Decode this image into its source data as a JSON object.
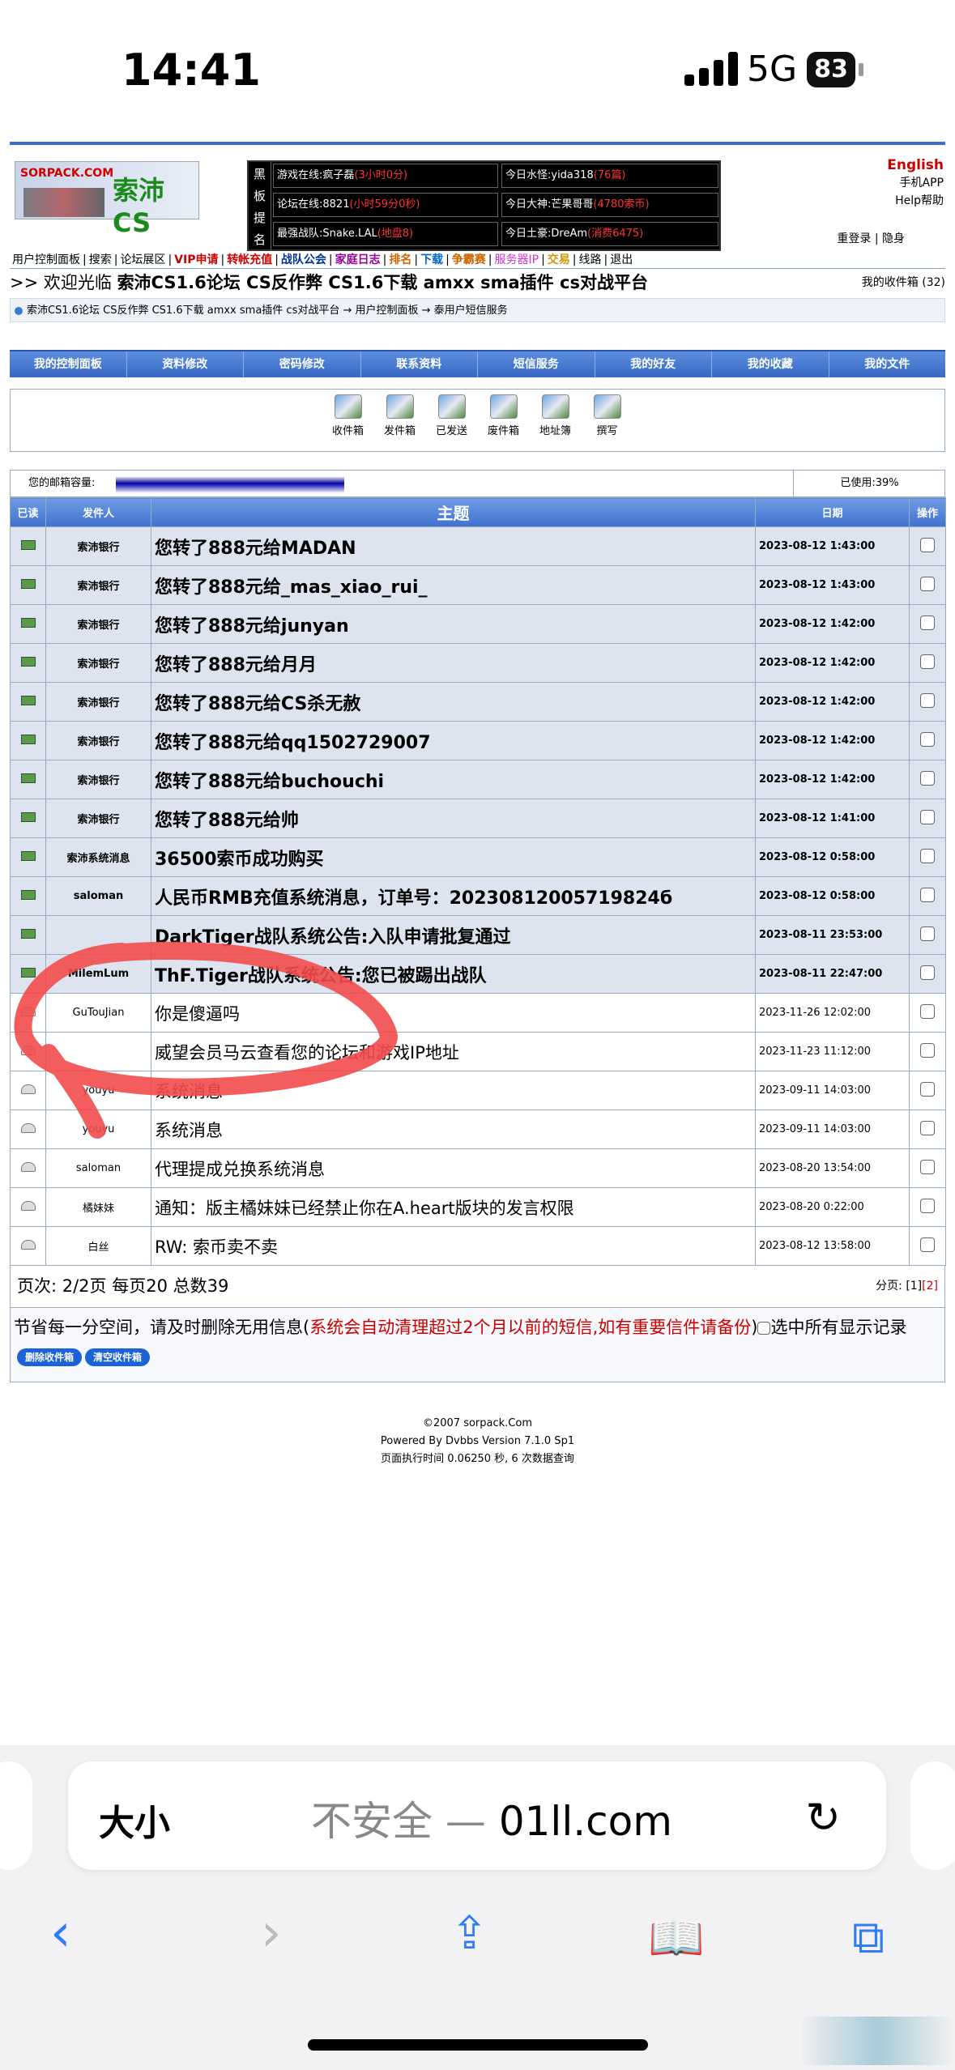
{
  "status": {
    "time": "14:41",
    "network": "5G",
    "battery": "83"
  },
  "header": {
    "logo_text": "SORPACK.COM",
    "logo_title": "索沛CS",
    "vert": [
      "黑",
      "板",
      "提",
      "名"
    ],
    "cells": [
      [
        "游戏在线:疯子磊",
        "(3小时0分)"
      ],
      [
        "今日水怪:yida318",
        "(76篇)"
      ],
      [
        "论坛在线:8821",
        "(小时59分0秒)"
      ],
      [
        "今日大神:芒果哥哥",
        "(4780索币)"
      ],
      [
        "最强战队:Snake.LAL",
        "(地盘8)"
      ],
      [
        "今日土豪:DreAm",
        "(消费6475)"
      ]
    ],
    "english": "English",
    "app": "手机APP",
    "help": "Help帮助",
    "relogin": "重登录",
    "hide": "隐身"
  },
  "menu": [
    "用户控制面板",
    "搜索",
    "论坛展区",
    "VIP申请",
    "转帐充值",
    "战队公会",
    "家庭日志",
    "排名",
    "下载",
    "争霸赛",
    "服务器IP",
    "交易",
    "线路",
    "退出"
  ],
  "welcome": {
    "prefix": ">> 欢迎光临",
    "site": "索沛CS1.6论坛 CS反作弊 CS1.6下载 amxx sma插件 cs对战平台",
    "fav": "我的收件箱 (32)"
  },
  "breadcrumb": "索沛CS1.6论坛 CS反作弊 CS1.6下载 amxx sma插件 cs对战平台 → 用户控制面板 → 泰用户短信服务",
  "tabs": [
    "我的控制面板",
    "资料修改",
    "密码修改",
    "联系资料",
    "短信服务",
    "我的好友",
    "我的收藏",
    "我的文件"
  ],
  "icons": [
    {
      "name": "inbox-icon",
      "label": "收件箱"
    },
    {
      "name": "outbox-icon",
      "label": "发件箱"
    },
    {
      "name": "sent-icon",
      "label": "已发送"
    },
    {
      "name": "trash-icon",
      "label": "废件箱"
    },
    {
      "name": "addressbook-icon",
      "label": "地址簿"
    },
    {
      "name": "compose-icon",
      "label": "撰写"
    }
  ],
  "capacity": {
    "label": "您的邮箱容量:",
    "used": "已使用:39%",
    "fraction": 0.39
  },
  "table": {
    "headers": [
      "已读",
      "发件人",
      "主题",
      "日期",
      "操作"
    ],
    "rows": [
      {
        "read": false,
        "sender": "索沛银行",
        "subject": "您转了888元给MADAN",
        "date": "2023-08-12 1:43:00"
      },
      {
        "read": false,
        "sender": "索沛银行",
        "subject": "您转了888元给_mas_xiao_rui_",
        "date": "2023-08-12 1:43:00"
      },
      {
        "read": false,
        "sender": "索沛银行",
        "subject": "您转了888元给junyan",
        "date": "2023-08-12 1:42:00"
      },
      {
        "read": false,
        "sender": "索沛银行",
        "subject": "您转了888元给月月",
        "date": "2023-08-12 1:42:00"
      },
      {
        "read": false,
        "sender": "索沛银行",
        "subject": "您转了888元给CS杀无赦",
        "date": "2023-08-12 1:42:00"
      },
      {
        "read": false,
        "sender": "索沛银行",
        "subject": "您转了888元给qq1502729007",
        "date": "2023-08-12 1:42:00"
      },
      {
        "read": false,
        "sender": "索沛银行",
        "subject": "您转了888元给buchouchi",
        "date": "2023-08-12 1:42:00"
      },
      {
        "read": false,
        "sender": "索沛银行",
        "subject": "您转了888元给帅",
        "date": "2023-08-12 1:41:00"
      },
      {
        "read": false,
        "sender": "索沛系统消息",
        "subject": "36500索币成功购买",
        "date": "2023-08-12 0:58:00"
      },
      {
        "read": false,
        "sender": "saloman",
        "subject": "人民币RMB充值系统消息，订单号：20230812005719824б",
        "date": "2023-08-12 0:58:00"
      },
      {
        "read": false,
        "sender": "",
        "subject": "DarkTiger战队系统公告:入队申请批复通过",
        "date": "2023-08-11 23:53:00"
      },
      {
        "read": false,
        "sender": "MilemLum",
        "subject": "ThF.Tiger战队系统公告:您已被踢出战队",
        "date": "2023-08-11 22:47:00"
      },
      {
        "read": true,
        "sender": "GuTouJian",
        "subject": "你是傻逼吗",
        "date": "2023-11-26 12:02:00"
      },
      {
        "read": true,
        "sender": "",
        "subject": "威望会员马云查看您的论坛和游戏IP地址",
        "date": "2023-11-23 11:12:00"
      },
      {
        "read": true,
        "sender": "youyu",
        "subject": "系统消息",
        "date": "2023-09-11 14:03:00"
      },
      {
        "read": true,
        "sender": "youyu",
        "subject": "系统消息",
        "date": "2023-09-11 14:03:00"
      },
      {
        "read": true,
        "sender": "saloman",
        "subject": "代理提成兑换系统消息",
        "date": "2023-08-20 13:54:00"
      },
      {
        "read": true,
        "sender": "橘妹妹",
        "subject": "通知：版主橘妹妹已经禁止你在A.heart版块的发言权限",
        "date": "2023-08-20 0:22:00"
      },
      {
        "read": true,
        "sender": "白丝",
        "subject": "RW: 索币卖不卖",
        "date": "2023-08-12 13:58:00"
      }
    ]
  },
  "pager": {
    "info": "页次: 2/2页 每页20 总数39",
    "label": "分页:",
    "p1": "[1]",
    "p2": "[2]"
  },
  "notice": {
    "text": "节省每一分空间，请及时删除无用信息(",
    "warn": "系统会自动清理超过2个月以前的短信,如有重要信件请备份",
    "close": ")",
    "select_all": "选中所有显示记录",
    "del_inbox": "删除收件箱",
    "clear_inbox": "清空收件箱"
  },
  "footer": {
    "copy": "©2007 sorpack.Com",
    "powered": "Powered By Dvbbs Version 7.1.0 Sp1",
    "exec": "页面执行时间 0.06250 秒, 6 次数据查询"
  },
  "safari": {
    "size": "大小",
    "insecure": "不安全 —",
    "domain": "01ll.com"
  },
  "colors": {
    "accent": "#3f72cf",
    "warn": "#cc0000",
    "link": "#2f7cf6"
  }
}
